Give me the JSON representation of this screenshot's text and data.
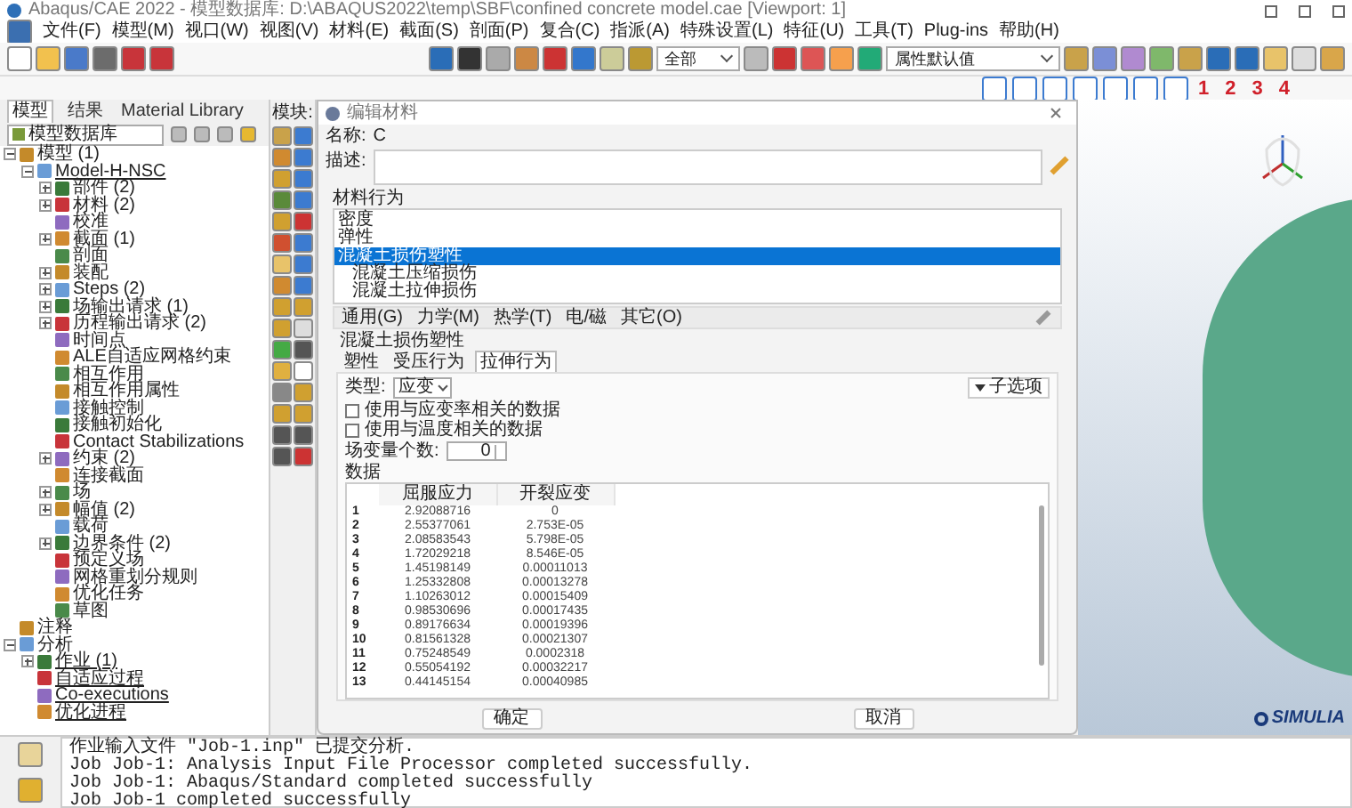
{
  "window": {
    "title": "Abaqus/CAE 2022 - 模型数据库: D:\\ABAQUS2022\\temp\\SBF\\confined concrete model.cae [Viewport: 1]"
  },
  "menu": [
    "文件(F)",
    "模型(M)",
    "视口(W)",
    "视图(V)",
    "材料(E)",
    "截面(S)",
    "剖面(P)",
    "复合(C)",
    "指派(A)",
    "特殊设置(L)",
    "特征(U)",
    "工具(T)",
    "Plug-ins",
    "帮助(H)"
  ],
  "toolbar": {
    "filter_dropdown": "全部",
    "attribute_dropdown": "属性默认值",
    "view_numbers": [
      "1",
      "2",
      "3",
      "4"
    ]
  },
  "model_tree": {
    "tabs": [
      {
        "label": "模型",
        "selected": true
      },
      {
        "label": "结果",
        "selected": false
      },
      {
        "label": "Material Library",
        "selected": false
      }
    ],
    "database_dropdown": "模型数据库",
    "items": [
      {
        "label": "模型 (1)",
        "expanded": true,
        "children": [
          {
            "label": "Model-H-NSC",
            "expanded": true,
            "children": [
              {
                "label": "部件 (2)",
                "expanded": false
              },
              {
                "label": "材料 (2)",
                "expanded": false
              },
              {
                "label": "校准"
              },
              {
                "label": "截面 (1)",
                "expanded": false
              },
              {
                "label": "剖面"
              },
              {
                "label": "装配",
                "expanded": false
              },
              {
                "label": "Steps (2)",
                "expanded": false
              },
              {
                "label": "场输出请求 (1)",
                "expanded": false
              },
              {
                "label": "历程输出请求 (2)",
                "expanded": false
              },
              {
                "label": "时间点"
              },
              {
                "label": "ALE自适应网格约束"
              },
              {
                "label": "相互作用"
              },
              {
                "label": "相互作用属性"
              },
              {
                "label": "接触控制"
              },
              {
                "label": "接触初始化"
              },
              {
                "label": "Contact Stabilizations"
              },
              {
                "label": "约束 (2)",
                "expanded": false
              },
              {
                "label": "连接截面"
              },
              {
                "label": "场",
                "expanded": false
              },
              {
                "label": "幅值 (2)",
                "expanded": false
              },
              {
                "label": "载荷"
              },
              {
                "label": "边界条件 (2)",
                "expanded": false
              },
              {
                "label": "预定义场"
              },
              {
                "label": "网格重划分规则"
              },
              {
                "label": "优化任务"
              },
              {
                "label": "草图"
              }
            ]
          }
        ]
      },
      {
        "label": "注释"
      },
      {
        "label": "分析",
        "expanded": true,
        "children": [
          {
            "label": "作业 (1)",
            "expanded": false
          },
          {
            "label": "自适应过程"
          },
          {
            "label": "Co-executions"
          },
          {
            "label": "优化进程"
          }
        ]
      }
    ]
  },
  "toolbox": {
    "label": "模块:"
  },
  "dialog": {
    "title": "编辑材料",
    "name_label": "名称:",
    "name": "C",
    "description_label": "描述:",
    "behaviors_label": "材料行为",
    "behaviors": [
      {
        "label": "密度",
        "selected": false
      },
      {
        "label": "弹性",
        "selected": false
      },
      {
        "label": "混凝土损伤塑性",
        "selected": true,
        "children": [
          {
            "label": "混凝土压缩损伤",
            "selected": false
          },
          {
            "label": "混凝土拉伸损伤",
            "selected": false
          }
        ]
      }
    ],
    "menus": [
      "通用(G)",
      "力学(M)",
      "热学(T)",
      "电/磁",
      "其它(O)"
    ],
    "section_title": "混凝土损伤塑性",
    "tabs": [
      {
        "label": "塑性",
        "selected": false
      },
      {
        "label": "受压行为",
        "selected": false
      },
      {
        "label": "拉伸行为",
        "selected": true
      }
    ],
    "type_label": "类型:",
    "type_value": "应变",
    "suboptions_button": "子选项",
    "checkboxes": [
      {
        "label": "使用与应变率相关的数据",
        "checked": false
      },
      {
        "label": "使用与温度相关的数据",
        "checked": false
      }
    ],
    "field_vars_label": "场变量个数:",
    "field_vars_value": "0",
    "data_label": "数据",
    "table": {
      "columns": [
        "",
        "屈服应力",
        "开裂应变"
      ],
      "rows": [
        [
          "1",
          "2.92088716",
          "0"
        ],
        [
          "2",
          "2.55377061",
          "2.753E-05"
        ],
        [
          "3",
          "2.08583543",
          "5.798E-05"
        ],
        [
          "4",
          "1.72029218",
          "8.546E-05"
        ],
        [
          "5",
          "1.45198149",
          "0.00011013"
        ],
        [
          "6",
          "1.25332808",
          "0.00013278"
        ],
        [
          "7",
          "1.10263012",
          "0.00015409"
        ],
        [
          "8",
          "0.98530696",
          "0.00017435"
        ],
        [
          "9",
          "0.89176634",
          "0.00019396"
        ],
        [
          "10",
          "0.81561328",
          "0.00021307"
        ],
        [
          "11",
          "0.75248549",
          "0.0002318"
        ],
        [
          "12",
          "0.55054192",
          "0.00032217"
        ],
        [
          "13",
          "0.44145154",
          "0.00040985"
        ]
      ]
    },
    "buttons": [
      "确定",
      "取消"
    ]
  },
  "viewport": {
    "logo": "SIMULIA"
  },
  "message_area": {
    "lines": [
      "作业输入文件 \"Job-1.inp\" 已提交分析.",
      "Job Job-1: Analysis Input File Processor completed successfully.",
      "Job Job-1: Abaqus/Standard completed successfully",
      "Job Job-1 completed successfully"
    ]
  }
}
